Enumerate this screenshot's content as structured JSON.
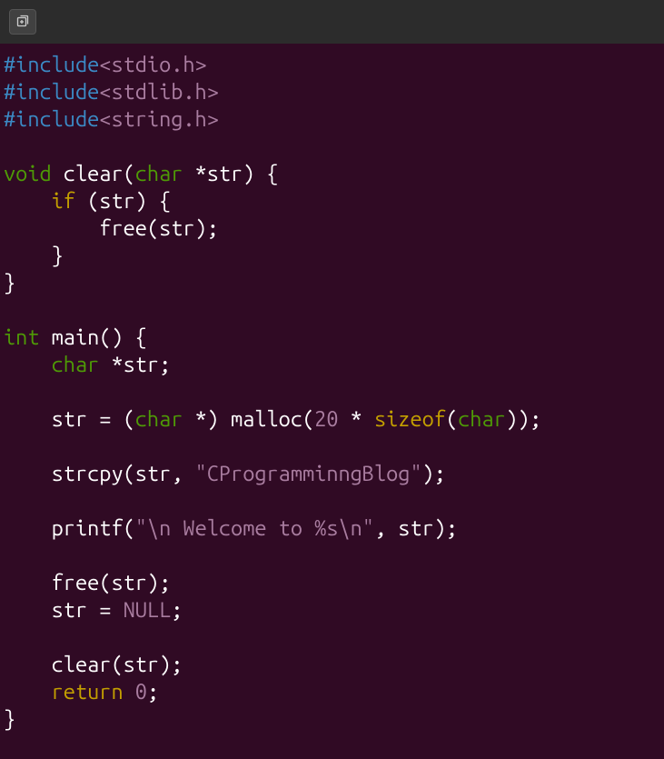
{
  "titlebar": {
    "new_tab_icon": "new-tab"
  },
  "colors": {
    "background": "#300a24",
    "titlebar": "#2c2c2c",
    "preproc": "#3b8ac5",
    "header": "#a97da0",
    "type": "#4e9a06",
    "keyword_yellow": "#c4a000",
    "text": "#ffffff",
    "literal": "#a97da0"
  },
  "code": {
    "lines": [
      {
        "tokens": [
          {
            "t": "preproc",
            "v": "#include"
          },
          {
            "t": "header",
            "v": "<stdio.h>"
          }
        ]
      },
      {
        "tokens": [
          {
            "t": "preproc",
            "v": "#include"
          },
          {
            "t": "header",
            "v": "<stdlib.h>"
          }
        ]
      },
      {
        "tokens": [
          {
            "t": "preproc",
            "v": "#include"
          },
          {
            "t": "header",
            "v": "<string.h>"
          }
        ]
      },
      {
        "tokens": []
      },
      {
        "tokens": [
          {
            "t": "type",
            "v": "void"
          },
          {
            "t": "plain",
            "v": " clear("
          },
          {
            "t": "type",
            "v": "char"
          },
          {
            "t": "plain",
            "v": " *str) {"
          }
        ]
      },
      {
        "tokens": [
          {
            "t": "plain",
            "v": "    "
          },
          {
            "t": "keyword-yellow",
            "v": "if"
          },
          {
            "t": "plain",
            "v": " (str) {"
          }
        ]
      },
      {
        "tokens": [
          {
            "t": "plain",
            "v": "        free(str);"
          }
        ]
      },
      {
        "tokens": [
          {
            "t": "plain",
            "v": "    }"
          }
        ]
      },
      {
        "tokens": [
          {
            "t": "plain",
            "v": "}"
          }
        ]
      },
      {
        "tokens": []
      },
      {
        "tokens": [
          {
            "t": "type",
            "v": "int"
          },
          {
            "t": "plain",
            "v": " main() {"
          }
        ]
      },
      {
        "tokens": [
          {
            "t": "plain",
            "v": "    "
          },
          {
            "t": "type",
            "v": "char"
          },
          {
            "t": "plain",
            "v": " *str;"
          }
        ]
      },
      {
        "tokens": []
      },
      {
        "tokens": [
          {
            "t": "plain",
            "v": "    str = ("
          },
          {
            "t": "type",
            "v": "char"
          },
          {
            "t": "plain",
            "v": " *) malloc("
          },
          {
            "t": "number",
            "v": "20"
          },
          {
            "t": "plain",
            "v": " * "
          },
          {
            "t": "keyword-yellow",
            "v": "sizeof"
          },
          {
            "t": "plain",
            "v": "("
          },
          {
            "t": "type",
            "v": "char"
          },
          {
            "t": "plain",
            "v": "));"
          }
        ]
      },
      {
        "tokens": []
      },
      {
        "tokens": [
          {
            "t": "plain",
            "v": "    strcpy(str, "
          },
          {
            "t": "string",
            "v": "\"CProgramminngBlog\""
          },
          {
            "t": "plain",
            "v": ");"
          }
        ]
      },
      {
        "tokens": []
      },
      {
        "tokens": [
          {
            "t": "plain",
            "v": "    printf("
          },
          {
            "t": "string",
            "v": "\"\\n Welcome to %s\\n\""
          },
          {
            "t": "plain",
            "v": ", str);"
          }
        ]
      },
      {
        "tokens": []
      },
      {
        "tokens": [
          {
            "t": "plain",
            "v": "    free(str);"
          }
        ]
      },
      {
        "tokens": [
          {
            "t": "plain",
            "v": "    str = "
          },
          {
            "t": "null",
            "v": "NULL"
          },
          {
            "t": "plain",
            "v": ";"
          }
        ]
      },
      {
        "tokens": []
      },
      {
        "tokens": [
          {
            "t": "plain",
            "v": "    clear(str);"
          }
        ]
      },
      {
        "tokens": [
          {
            "t": "plain",
            "v": "    "
          },
          {
            "t": "keyword-yellow",
            "v": "return"
          },
          {
            "t": "plain",
            "v": " "
          },
          {
            "t": "number",
            "v": "0"
          },
          {
            "t": "plain",
            "v": ";"
          }
        ]
      },
      {
        "tokens": [
          {
            "t": "plain",
            "v": "}"
          }
        ]
      }
    ]
  }
}
